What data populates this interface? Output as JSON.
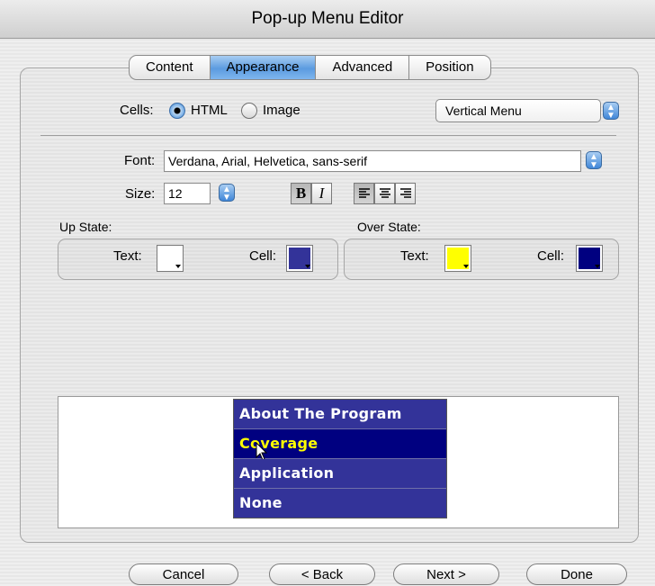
{
  "window": {
    "title": "Pop-up Menu Editor"
  },
  "tabs": [
    {
      "label": "Content",
      "active": false
    },
    {
      "label": "Appearance",
      "active": true
    },
    {
      "label": "Advanced",
      "active": false
    },
    {
      "label": "Position",
      "active": false
    }
  ],
  "cells": {
    "label": "Cells:",
    "options": [
      {
        "label": "HTML",
        "selected": true
      },
      {
        "label": "Image",
        "selected": false
      }
    ]
  },
  "orientation": {
    "selected": "Vertical Menu"
  },
  "font": {
    "label": "Font:",
    "value": "Verdana, Arial, Helvetica, sans-serif"
  },
  "size": {
    "label": "Size:",
    "value": "12"
  },
  "format_buttons": {
    "bold": "B",
    "italic": "I",
    "bold_pressed": true
  },
  "up_state": {
    "title": "Up State:",
    "text_label": "Text:",
    "text_color": "#ffffff",
    "cell_label": "Cell:",
    "cell_color": "#333399"
  },
  "over_state": {
    "title": "Over State:",
    "text_label": "Text:",
    "text_color": "#ffff00",
    "cell_label": "Cell:",
    "cell_color": "#000080"
  },
  "preview_menu": {
    "items": [
      {
        "label": "About The Program",
        "over": false
      },
      {
        "label": "Coverage",
        "over": true
      },
      {
        "label": "Application",
        "over": false
      },
      {
        "label": "None",
        "over": false
      }
    ]
  },
  "buttons": {
    "cancel": "Cancel",
    "back": "< Back",
    "next": "Next >",
    "done": "Done"
  },
  "colors": {
    "accent": "#5b9be0"
  }
}
